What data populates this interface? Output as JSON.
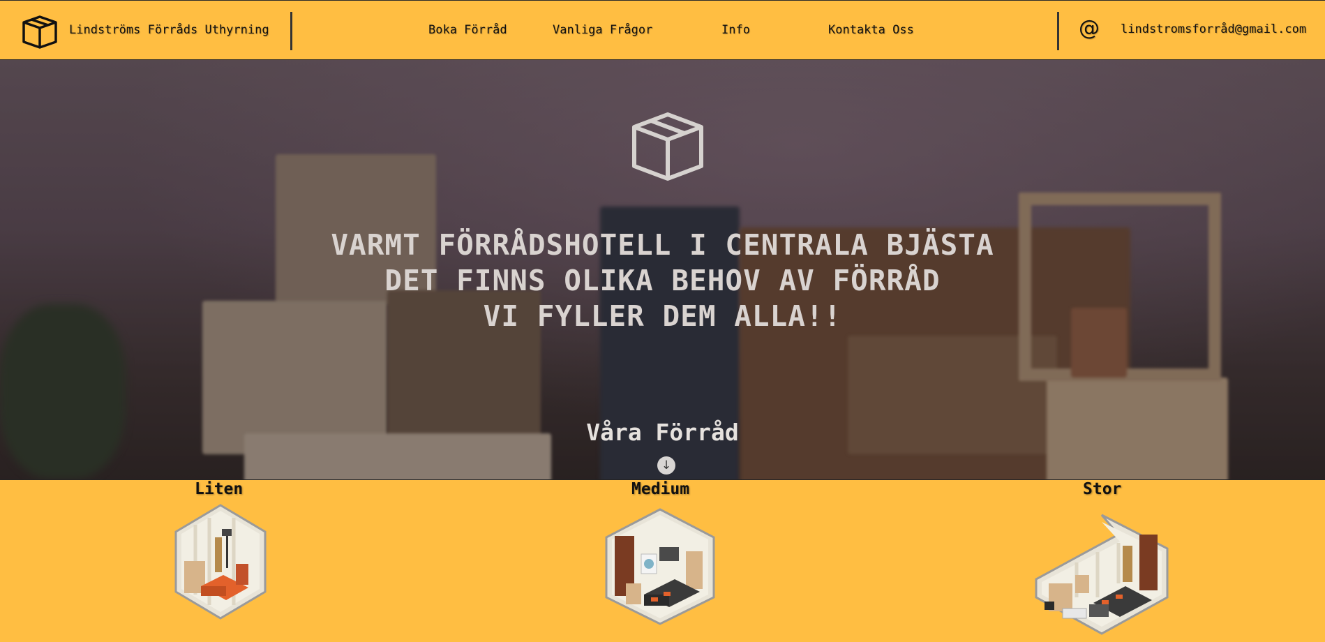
{
  "header": {
    "brand": "Lindströms Förråds Uthyrning",
    "nav": [
      {
        "label": "Boka Förråd"
      },
      {
        "label": "Vanliga Frågor"
      },
      {
        "label": "Info"
      },
      {
        "label": "Kontakta Oss"
      }
    ],
    "contact_symbol": "@",
    "email": "lindstromsforråd@gmail.com"
  },
  "hero": {
    "title_lines": [
      "VARMT FÖRRÅDSHOTELL I CENTRALA BJÄSTA",
      "DET FINNS OLIKA BEHOV AV FÖRRÅD",
      "VI FYLLER DEM ALLA!!"
    ],
    "section_link": "Våra Förråd",
    "down_icon": "arrow-down-circle-icon"
  },
  "storage": [
    {
      "title": "Liten",
      "image": "small-storage-unit-illustration"
    },
    {
      "title": "Medium",
      "image": "medium-storage-unit-illustration"
    },
    {
      "title": "Stor",
      "image": "large-storage-unit-illustration"
    }
  ],
  "colors": {
    "accent": "#FFBE42",
    "text": "#111111",
    "hero_text": "#D9D3D0"
  }
}
